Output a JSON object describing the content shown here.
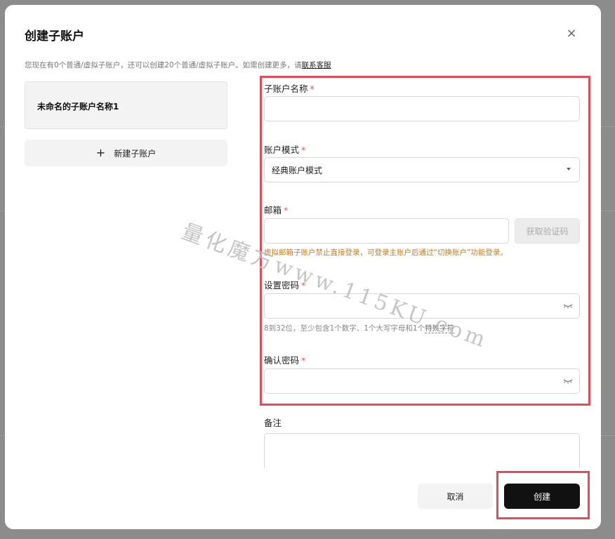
{
  "dialog": {
    "title": "创建子账户",
    "close_icon": "×"
  },
  "notice": {
    "text": "您现在有0个普通/虚拟子账户，还可以创建20个普通/虚拟子账户。如需创建更多，请",
    "link": "联系客服"
  },
  "sidebar": {
    "selected_account": "未命名的子账户名称1",
    "add_button": {
      "icon": "+",
      "label": "新建子账户"
    }
  },
  "form": {
    "name": {
      "label": "子账户名称",
      "required_mark": "*",
      "value": ""
    },
    "mode": {
      "label": "账户模式",
      "required_mark": "*",
      "selected": "经典账户模式"
    },
    "email": {
      "label": "邮箱",
      "required_mark": "*",
      "value": "",
      "code_button": "获取验证码",
      "warning": "虚拟邮箱子账户禁止直接登录，可登录主账户后通过“切换账户”功能登录。"
    },
    "password": {
      "label": "设置密码",
      "required_mark": "*",
      "value": "",
      "hint": "8到32位，至少包含1个数字、1个大写字母和1个",
      "hint_link": "特殊字符"
    },
    "confirm_password": {
      "label": "确认密码",
      "required_mark": "*",
      "value": ""
    },
    "remark": {
      "label": "备注",
      "value": ""
    }
  },
  "footer": {
    "cancel": "取消",
    "create": "创建"
  },
  "watermark": "量化魔方www.115KU.com",
  "colors": {
    "highlight": "#e44c5a",
    "required": "#e0565d",
    "warning": "#c77a1a",
    "primary_button": "#111111"
  },
  "icons": {
    "close": "close-icon",
    "plus": "plus-icon",
    "dropdown": "chevron-down-icon",
    "password_toggle": "eye-closed-icon"
  }
}
